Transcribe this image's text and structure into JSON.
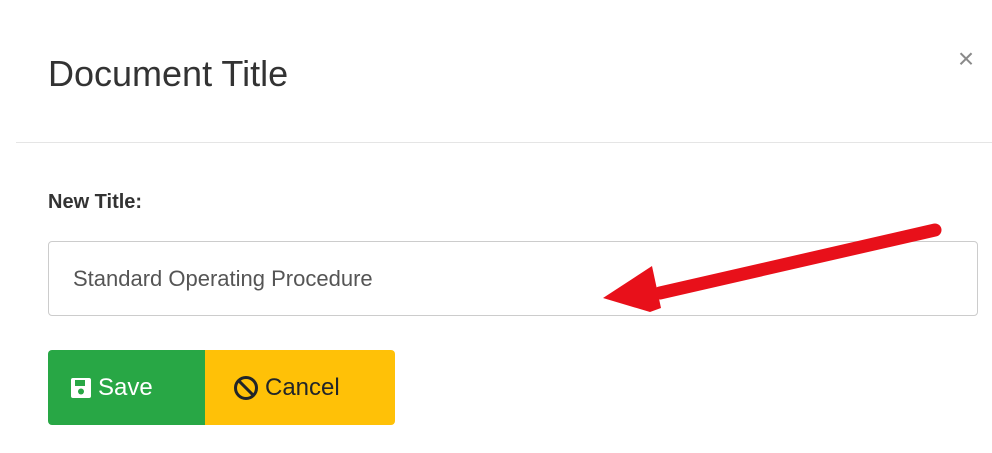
{
  "dialog": {
    "title": "Document Title",
    "close_label": "×"
  },
  "form": {
    "field_label": "New Title:",
    "title_value": "Standard Operating Procedure"
  },
  "buttons": {
    "save_label": "Save",
    "cancel_label": "Cancel"
  },
  "icons": {
    "save": "floppy-disk-icon",
    "cancel": "ban-icon",
    "annotation": "red-arrow-annotation"
  },
  "colors": {
    "save_bg": "#28a745",
    "cancel_bg": "#ffc107",
    "arrow": "#e8101a"
  }
}
